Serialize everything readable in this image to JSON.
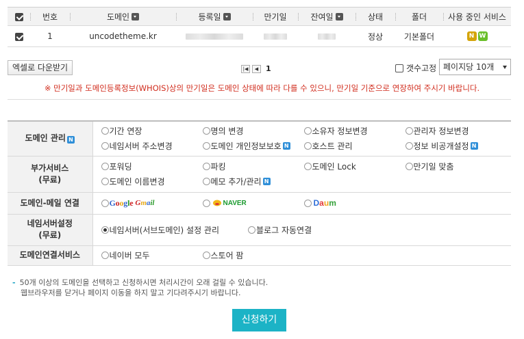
{
  "domain_table": {
    "headers": {
      "number": "번호",
      "domain": "도메인",
      "registered": "등록일",
      "expiry": "만기일",
      "remaining": "잔여일",
      "status": "상태",
      "folder": "폴더",
      "services": "사용 중인 서비스"
    },
    "rows": [
      {
        "number": "1",
        "domain": "uncodetheme.kr",
        "status": "정상",
        "folder": "기본폴더",
        "services": [
          "N",
          "W"
        ]
      }
    ]
  },
  "toolbar": {
    "excel_label": "엑셀로 다운받기",
    "current_page": "1",
    "fix_count_label": "갯수고정",
    "per_page_value": "페이지당 10개"
  },
  "notice": "※ 만기일과 도메인등록정보(WHOIS)상의 만기일은 도메인 상태에 따라 다를 수 있으니, 만기일 기준으로 연장하여 주시기 바랍니다.",
  "services": {
    "domain_mgmt": {
      "label": "도메인 관리",
      "badge": "N",
      "options": [
        "기간 연장",
        "명의 변경",
        "소유자 정보변경",
        "관리자 정보변경",
        "네임서버 주소변경",
        "도메인 개인정보보호",
        "호스트 관리",
        "정보 비공개설정"
      ]
    },
    "extra": {
      "label": "부가서비스",
      "label2": "(무료)",
      "options": [
        "포워딩",
        "파킹",
        "도메인 Lock",
        "만기일 맞춤",
        "도메인 이름변경",
        "메모 추가/관리"
      ]
    },
    "mail": {
      "label": "도메인-메일 연결",
      "google": "Google",
      "gmail": "Gmail",
      "naver": "NAVER",
      "daum": "Daum"
    },
    "nameserver": {
      "label": "네임서버설정",
      "label2": "(무료)",
      "options": [
        "네임서버(서브도메인) 설정 관리",
        "블로그 자동연결"
      ]
    },
    "connect": {
      "label": "도메인연결서비스",
      "options": [
        "네이버 모두",
        "스토어 팜"
      ]
    }
  },
  "footer": {
    "line1": "50개 이상의 도메인을 선택하고 신청하시면 처리시간이 오래 걸릴 수 있습니다.",
    "line2": "웹브라우저를 닫거나 페이지 이동을 하지 말고 기다려주시기 바랍니다."
  },
  "apply_label": "신청하기",
  "colors": {
    "accent": "#1cb3c6",
    "notice_red": "#d12c1d",
    "badge_n": "#2f8fd8",
    "service_n": "#d4a40a",
    "service_w": "#6abf2a"
  }
}
